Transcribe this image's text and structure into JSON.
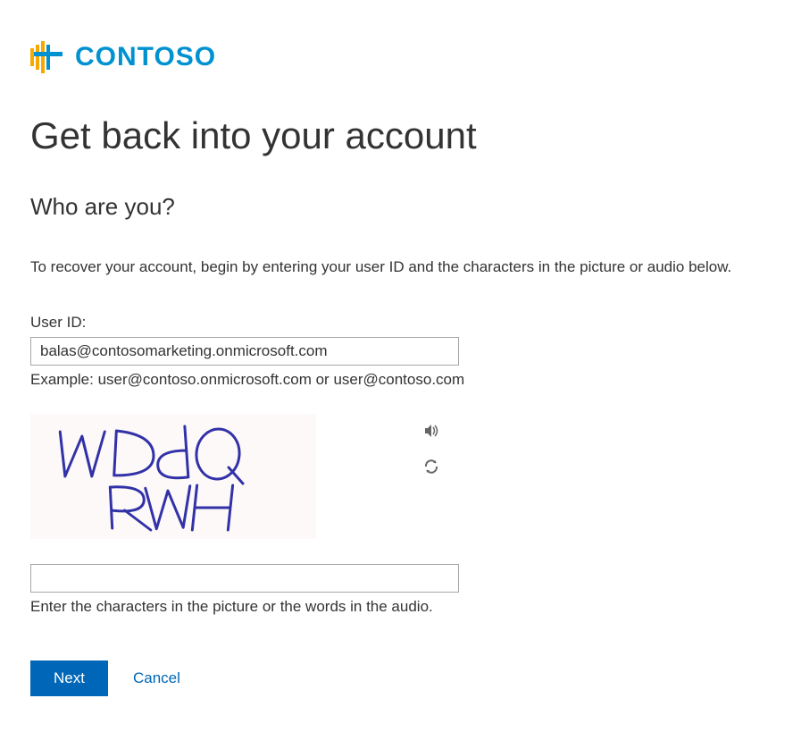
{
  "brand": {
    "name": "CONTOSO"
  },
  "page": {
    "heading": "Get back into your account",
    "subheading": "Who are you?",
    "instructions": "To recover your account, begin by entering your user ID and the characters in the picture or audio below."
  },
  "userid": {
    "label": "User ID:",
    "value": "balas@contosomarketing.onmicrosoft.com",
    "hint": "Example: user@contoso.onmicrosoft.com or user@contoso.com"
  },
  "captcha": {
    "text": "WDdQ RWH",
    "input_value": "",
    "hint": "Enter the characters in the picture or the words in the audio."
  },
  "buttons": {
    "next": "Next",
    "cancel": "Cancel"
  }
}
